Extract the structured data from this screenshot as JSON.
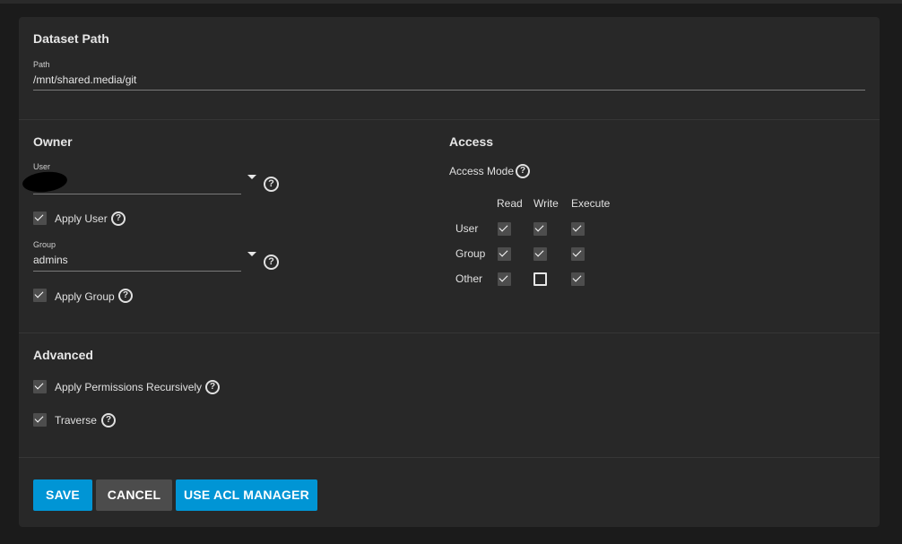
{
  "dataset": {
    "title": "Dataset Path",
    "path_label": "Path",
    "path_value": "/mnt/shared.media/git"
  },
  "owner": {
    "title": "Owner",
    "user_label": "User",
    "user_value": "",
    "apply_user_label": "Apply User",
    "group_label": "Group",
    "group_value": "admins",
    "apply_group_label": "Apply Group"
  },
  "access": {
    "title": "Access",
    "mode_label": "Access Mode",
    "columns": [
      "Read",
      "Write",
      "Execute"
    ],
    "rows": [
      "User",
      "Group",
      "Other"
    ],
    "matrix": [
      [
        true,
        true,
        true
      ],
      [
        true,
        true,
        true
      ],
      [
        true,
        false,
        true
      ]
    ]
  },
  "advanced": {
    "title": "Advanced",
    "recursive_label": "Apply Permissions Recursively",
    "traverse_label": "Traverse"
  },
  "buttons": {
    "save": "SAVE",
    "cancel": "CANCEL",
    "acl": "USE ACL MANAGER"
  },
  "icons": {
    "help": "?"
  },
  "colors": {
    "accent": "#0095d5",
    "secondary_button": "#4c4c4c",
    "card": "#282828",
    "background": "#1b1b1b"
  }
}
